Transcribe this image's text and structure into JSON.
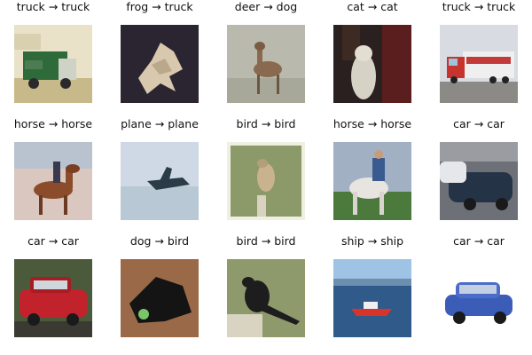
{
  "grid": {
    "images": [
      {
        "label": "truck → truck"
      },
      {
        "label": "frog → truck"
      },
      {
        "label": "deer → dog"
      },
      {
        "label": "cat → cat"
      },
      {
        "label": "truck → truck"
      },
      {
        "label": "horse → horse"
      },
      {
        "label": "plane → plane"
      },
      {
        "label": "bird → bird"
      },
      {
        "label": "horse → horse"
      },
      {
        "label": "car → car"
      },
      {
        "label": "car → car"
      },
      {
        "label": "dog → bird"
      },
      {
        "label": "bird → bird"
      },
      {
        "label": "ship → ship"
      },
      {
        "label": "car → car"
      }
    ]
  }
}
